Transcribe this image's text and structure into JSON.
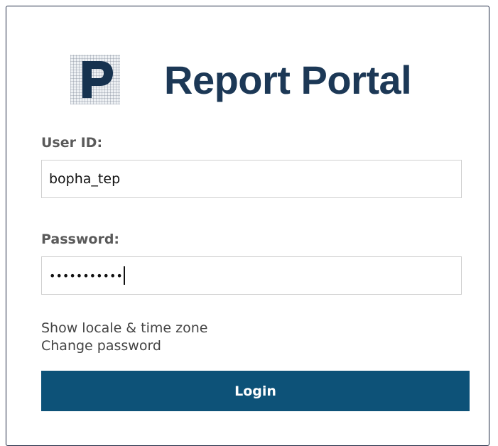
{
  "brand": {
    "logo_letter": "P",
    "title": "Report Portal",
    "title_color": "#1c3856"
  },
  "form": {
    "user_label": "User ID:",
    "user_value": "bopha_tep",
    "password_label": "Password:",
    "password_masked": "•••••••••••",
    "password_length": 11
  },
  "links": {
    "show_locale": "Show locale & time zone",
    "change_password": "Change password"
  },
  "actions": {
    "login_label": "Login",
    "login_color": "#0d5278"
  }
}
